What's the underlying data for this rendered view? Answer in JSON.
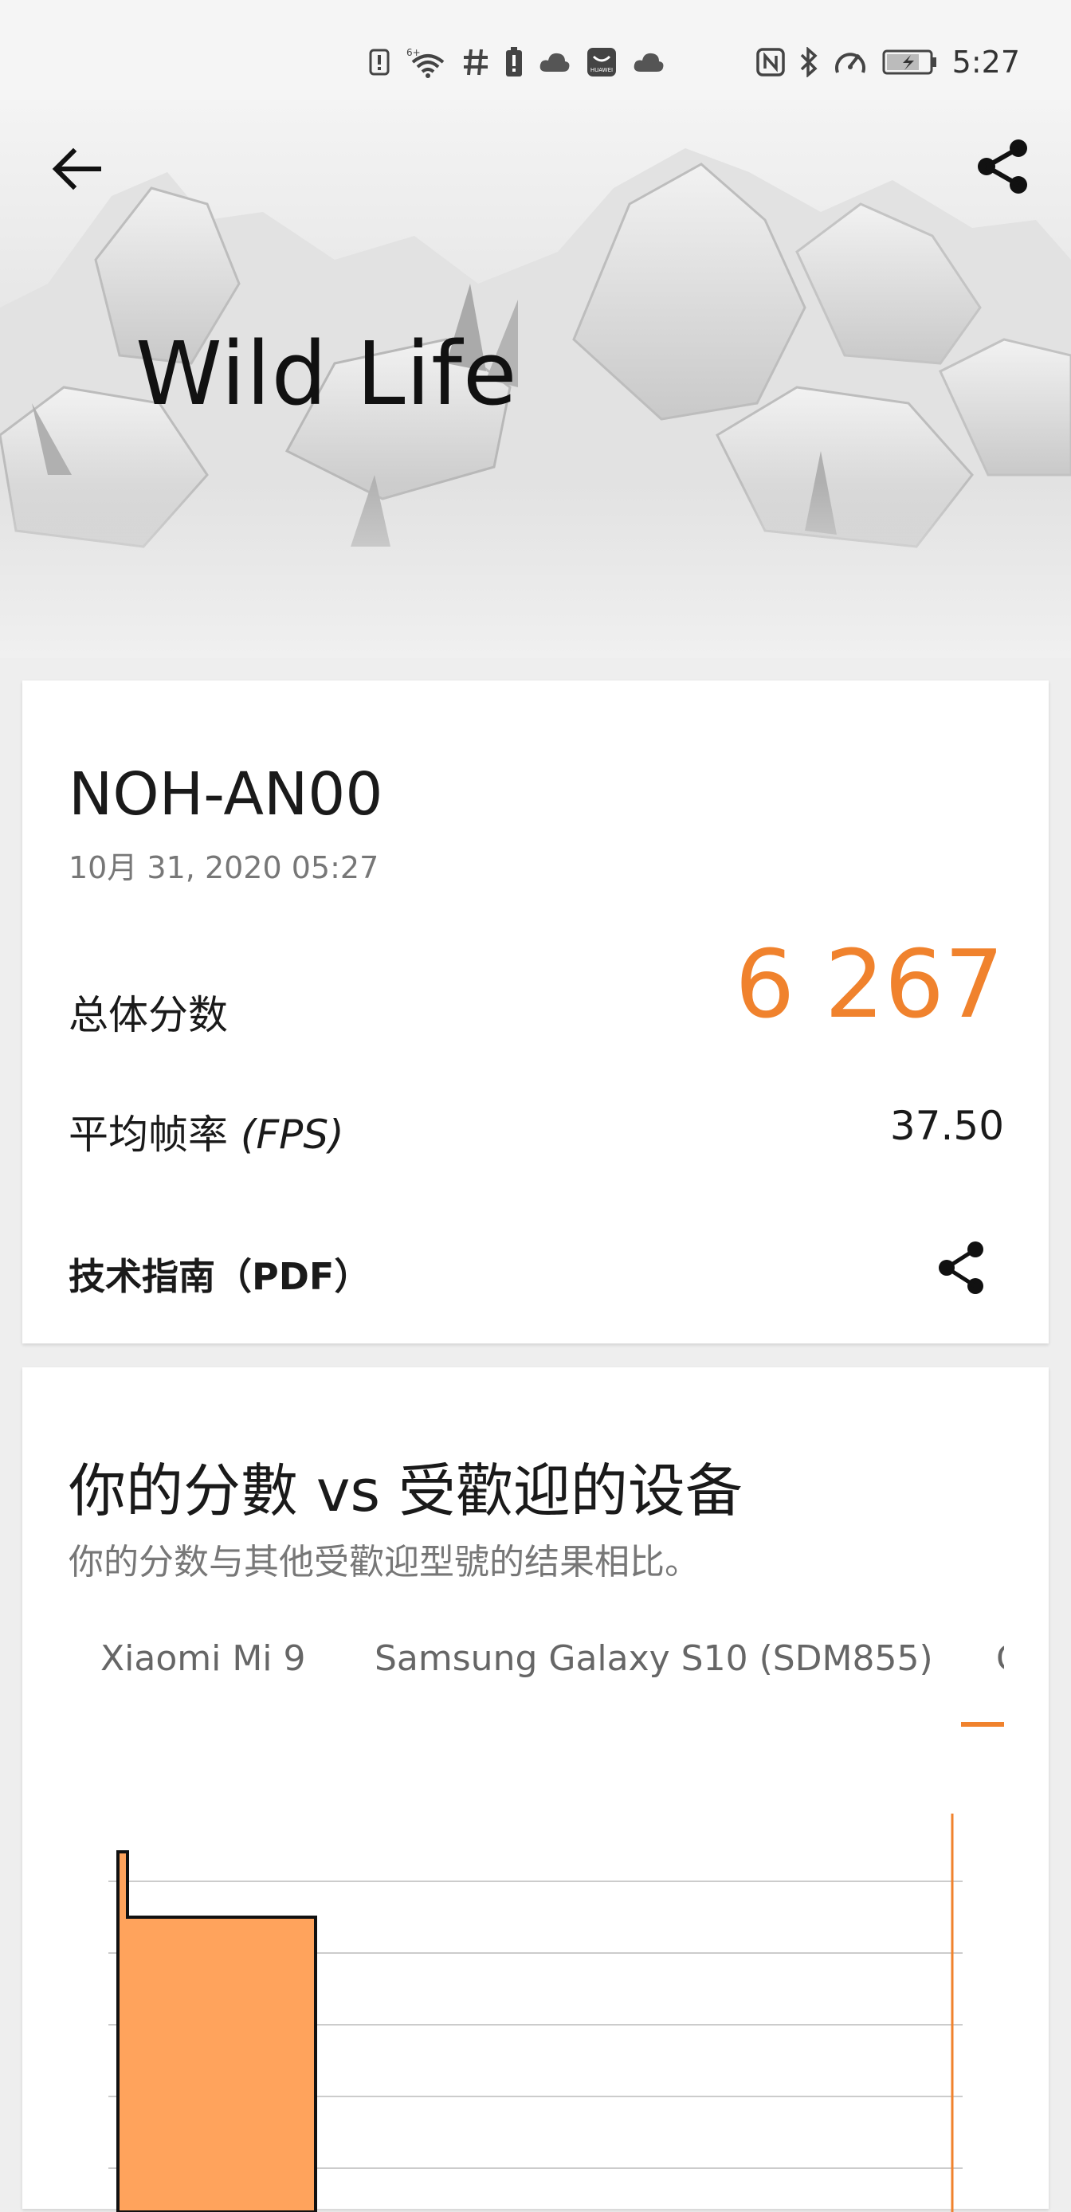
{
  "status_bar": {
    "time": "5:27",
    "left_icons": [
      "notification-alert-icon",
      "wifi-6plus-icon",
      "hash-icon",
      "battery-alert-icon",
      "cloud-icon",
      "huawei-app-icon",
      "cloud-icon"
    ],
    "right_icons": [
      "nfc-icon",
      "bluetooth-icon",
      "speed-icon",
      "battery-charging-icon"
    ],
    "huawei_badge": "HUAWEI"
  },
  "hero": {
    "title": "Wild Life"
  },
  "result": {
    "device": "NOH-AN00",
    "date": "10月 31, 2020 05:27",
    "score_label": "总体分数",
    "score_value": "6 267",
    "fps_label_prefix": "平均帧率 ",
    "fps_label_unit": "(FPS)",
    "fps_value": "37.50",
    "pdf_label": "技术指南（PDF）"
  },
  "compare": {
    "title": "你的分數 vs 受歡迎的设备",
    "subtitle": "你的分数与其他受歡迎型號的结果相比。",
    "tabs": [
      "Xiaomi Mi 9",
      "Samsung Galaxy S10 (SDM855)",
      "G"
    ],
    "active_tab_index": 2
  },
  "colors": {
    "accent": "#f0822d",
    "bar_fill": "#ffa35c"
  }
}
